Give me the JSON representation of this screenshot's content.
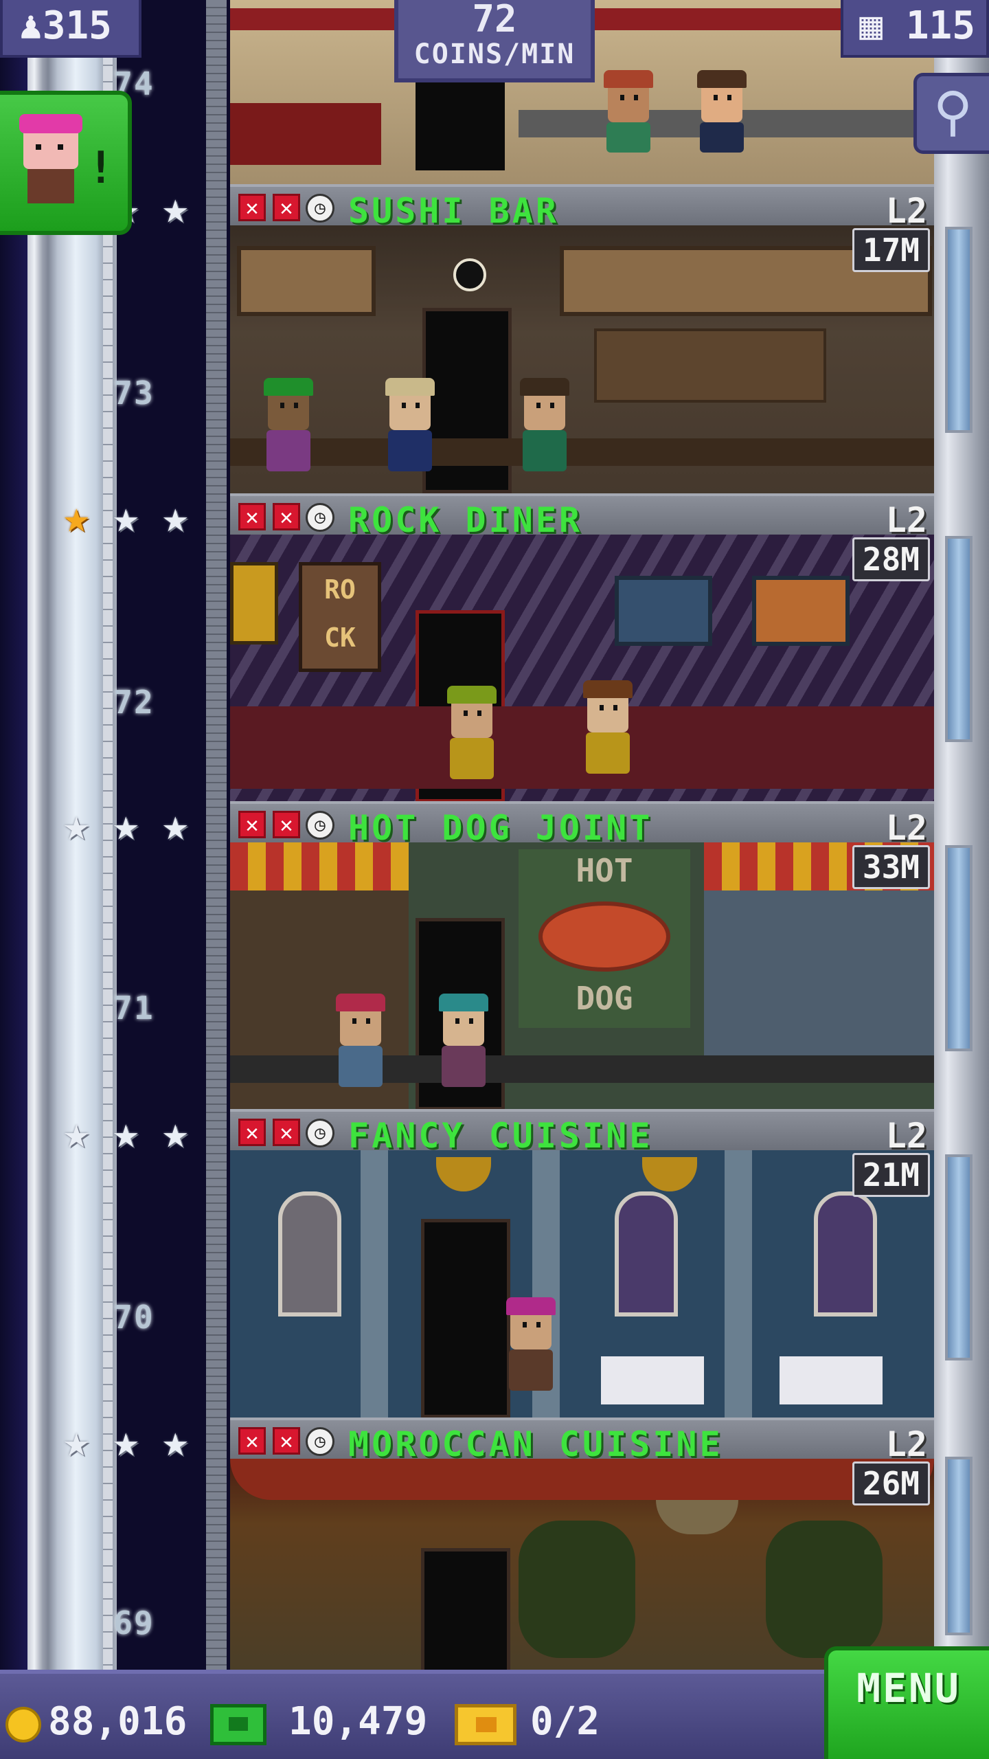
{
  "hud": {
    "population": "315",
    "coins_per_min_value": "72",
    "coins_per_min_label": "COINS/MIN",
    "floors": "115"
  },
  "icons": {
    "population": "person-icon",
    "floors": "building-icon",
    "search": "magnifier-icon",
    "mission": "bitizen-portrait-icon",
    "coin": "coin-icon",
    "bux": "bux-icon",
    "ticket": "vip-ticket-icon"
  },
  "mission": {
    "alert": "!"
  },
  "floor_numbers": [
    "74",
    "73",
    "72",
    "71",
    "70",
    "69"
  ],
  "floors": [
    {
      "name": "SUSHI BAR",
      "level": "L2",
      "income": "17M",
      "stars_gold": 0
    },
    {
      "name": "ROCK DINER",
      "level": "L2",
      "income": "28M",
      "stars_gold": 1
    },
    {
      "name": "HOT DOG JOINT",
      "level": "L2",
      "income": "33M",
      "stars_gold": 0
    },
    {
      "name": "FANCY CUISINE",
      "level": "L2",
      "income": "21M",
      "stars_gold": 0
    },
    {
      "name": "MOROCCAN CUISINE",
      "level": "L2",
      "income": "26M",
      "stars_gold": 0
    }
  ],
  "scene_text": {
    "rock_sign_1": "RO",
    "rock_sign_2": "CK",
    "hotdog_sign_top": "HOT",
    "hotdog_sign_bottom": "DOG"
  },
  "bottom_bar": {
    "coins": "88,016",
    "bux": "10,479",
    "tickets": "0/2",
    "menu_label": "MENU"
  },
  "colors": {
    "floor_name": "#3ee33e",
    "menu_button": "#2fbf3a",
    "hud_panel": "#4e4c8a",
    "star_gold": "#f6a91e",
    "star_silver": "#e9eef5"
  }
}
